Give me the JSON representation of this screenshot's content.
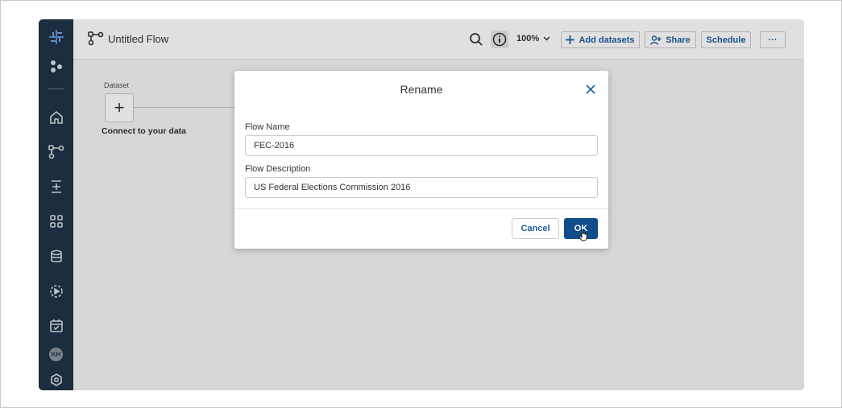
{
  "app": {
    "flow_title": "Untitled Flow",
    "zoom": "100%",
    "add_datasets_label": "Add datasets",
    "share_label": "Share",
    "schedule_label": "Schedule",
    "more_label": "···"
  },
  "sidebar": {
    "avatar_initials": "KH"
  },
  "canvas": {
    "dataset_label": "Dataset",
    "add_symbol": "+",
    "connect_text": "Connect to your data"
  },
  "dialog": {
    "title": "Rename",
    "flow_name_label": "Flow Name",
    "flow_name_value": "FEC-2016",
    "flow_description_label": "Flow Description",
    "flow_description_value": "US Federal Elections Commission 2016",
    "cancel_label": "Cancel",
    "ok_label": "OK"
  },
  "colors": {
    "sidebar_bg": "#1f3447",
    "accent": "#1f5fa0",
    "primary_button": "#0f4d8c"
  }
}
